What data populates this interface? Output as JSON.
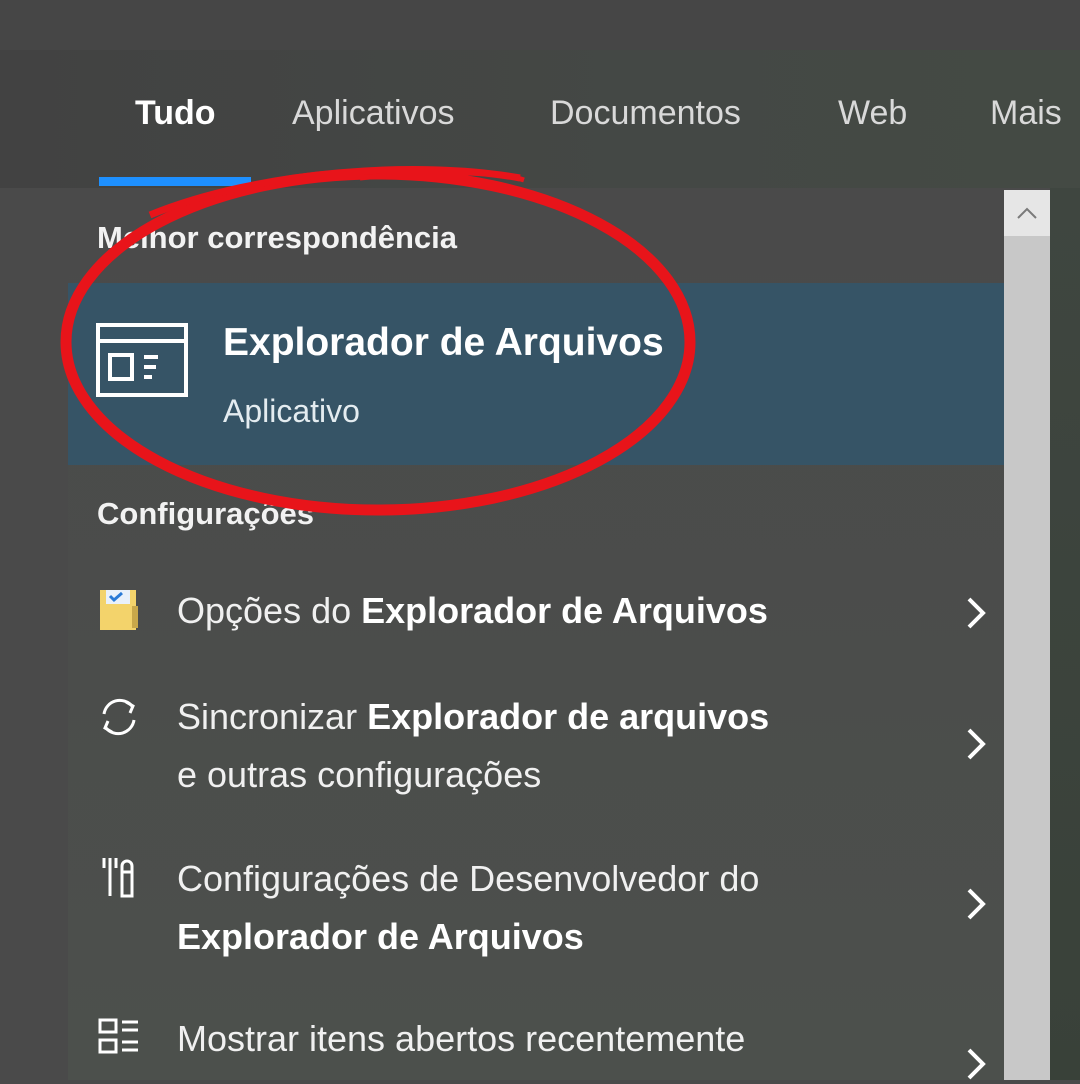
{
  "tabs": [
    {
      "label": "Tudo",
      "active": true
    },
    {
      "label": "Aplicativos"
    },
    {
      "label": "Documentos"
    },
    {
      "label": "Web"
    },
    {
      "label": "Mais"
    }
  ],
  "best_match": {
    "section_title": "Melhor correspondência",
    "title": "Explorador de Arquivos",
    "subtitle": "Aplicativo",
    "icon": "file-explorer-icon"
  },
  "settings": {
    "section_title": "Configurações",
    "items": [
      {
        "icon": "folder-options-icon",
        "line1_normal": "Opções do ",
        "line1_bold": "Explorador de Arquivos",
        "line2_normal": "",
        "line2_bold": ""
      },
      {
        "icon": "sync-icon",
        "line1_normal": "Sincronizar ",
        "line1_bold": "Explorador de arquivos",
        "line2_normal": "e outras configurações",
        "line2_bold": ""
      },
      {
        "icon": "developer-tools-icon",
        "line1_normal": "Configurações de Desenvolvedor do",
        "line1_bold": "",
        "line2_normal": "",
        "line2_bold": "Explorador de Arquivos"
      },
      {
        "icon": "recent-items-icon",
        "line1_normal": "Mostrar itens abertos recentemente",
        "line1_bold": "",
        "line2_normal": "",
        "line2_bold": ""
      }
    ]
  },
  "colors": {
    "accent": "#1e90ff",
    "selection": "#365466",
    "annotation": "#e8141a"
  }
}
